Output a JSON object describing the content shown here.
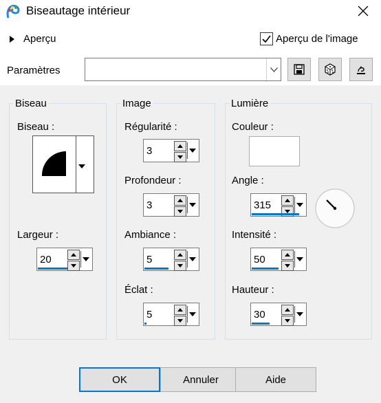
{
  "window": {
    "title": "Biseautage intérieur",
    "icon": "paint-app-icon",
    "close_icon": "close-icon"
  },
  "preview": {
    "toggle_label": "Aperçu",
    "expanded": false,
    "image_preview_label": "Aperçu de l'image",
    "image_preview_checked": true
  },
  "params": {
    "label": "Paramètres",
    "value": "",
    "save_icon": "save-icon",
    "random_icon": "dice-icon",
    "reset_icon": "reset-icon"
  },
  "bevel_group": {
    "title": "Biseau",
    "bevel_label": "Biseau :",
    "width_label": "Largeur :",
    "width_value": "20",
    "width_fill": 0.55
  },
  "image_group": {
    "title": "Image",
    "smoothness_label": "Régularité :",
    "smoothness_value": "3",
    "depth_label": "Profondeur :",
    "depth_value": "3",
    "ambience_label": "Ambiance :",
    "ambience_value": "5",
    "ambience_fill": 0.45,
    "shininess_label": "Éclat :",
    "shininess_value": "5",
    "shininess_fill": 0.04
  },
  "light_group": {
    "title": "Lumière",
    "color_label": "Couleur :",
    "color_value": "#ffffff",
    "angle_label": "Angle :",
    "angle_value": "315",
    "angle_fill": 0.88,
    "intensity_label": "Intensité :",
    "intensity_value": "50",
    "intensity_fill": 0.5,
    "height_label": "Hauteur :",
    "height_value": "30",
    "height_fill": 0.33
  },
  "buttons": {
    "ok": "OK",
    "cancel": "Annuler",
    "help": "Aide"
  },
  "colors": {
    "accent": "#0078d7",
    "dialog_bg": "#f0f0f0"
  }
}
